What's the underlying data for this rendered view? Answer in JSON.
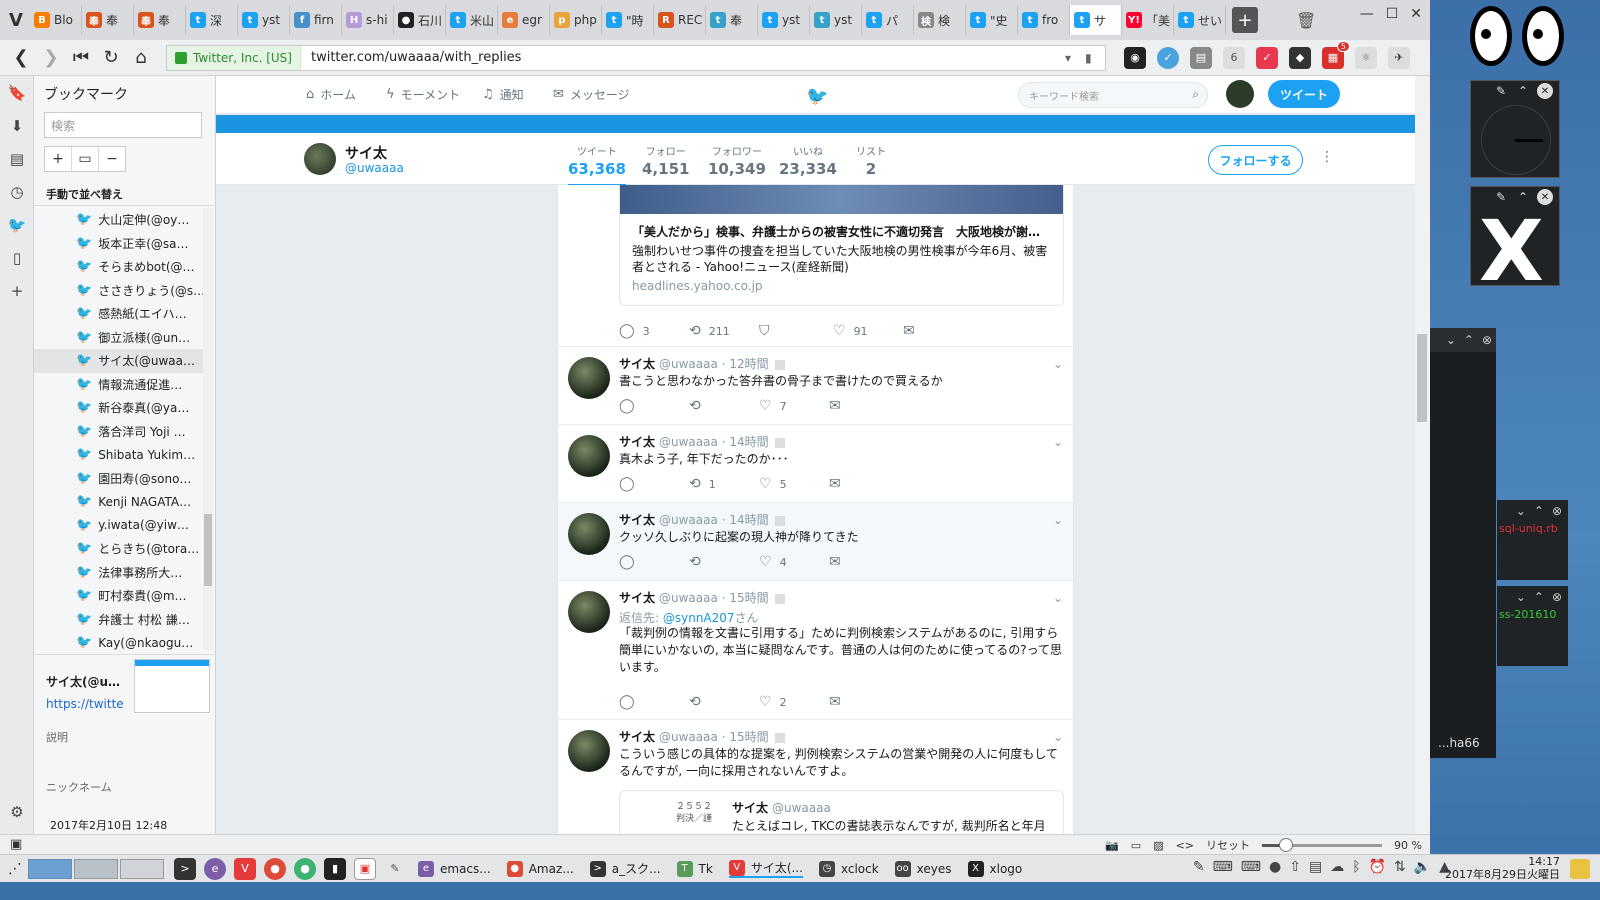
{
  "browser": {
    "tabs": [
      {
        "label": "Blo",
        "icon": "blogger-icon",
        "color": "#f57d00",
        "glyph": "B"
      },
      {
        "label": "奉",
        "icon": "fox-icon",
        "color": "#d9531e",
        "glyph": "奉"
      },
      {
        "label": "奉",
        "icon": "fox-icon",
        "color": "#d9531e",
        "glyph": "奉"
      },
      {
        "label": "深",
        "icon": "twitter-icon",
        "color": "#1da1f2",
        "glyph": "t"
      },
      {
        "label": "yst",
        "icon": "twitter-icon",
        "color": "#1da1f2",
        "glyph": "t"
      },
      {
        "label": "firn",
        "icon": "firn-icon",
        "color": "#4a90c8",
        "glyph": "f"
      },
      {
        "label": "s-hi",
        "icon": "s-icon",
        "color": "#b59ad8",
        "glyph": "H"
      },
      {
        "label": "石川",
        "icon": "github-icon",
        "color": "#222222",
        "glyph": "●"
      },
      {
        "label": "米山",
        "icon": "twitter-icon",
        "color": "#1da1f2",
        "glyph": "t"
      },
      {
        "label": "egr",
        "icon": "egr-icon",
        "color": "#e57c3a",
        "glyph": "e"
      },
      {
        "label": "php",
        "icon": "php-icon",
        "color": "#e8a33a",
        "glyph": "p"
      },
      {
        "label": "\"時",
        "icon": "twitter-icon",
        "color": "#1da1f2",
        "glyph": "t"
      },
      {
        "label": "REC",
        "icon": "rec-icon",
        "color": "#d9531e",
        "glyph": "R"
      },
      {
        "label": "奉",
        "icon": "tumblr-icon",
        "color": "#35a0c8",
        "glyph": "t"
      },
      {
        "label": "yst",
        "icon": "twitter-icon",
        "color": "#1da1f2",
        "glyph": "t"
      },
      {
        "label": "yst",
        "icon": "tumblr-icon",
        "color": "#35a0c8",
        "glyph": "t"
      },
      {
        "label": "パ",
        "icon": "twitter-icon",
        "color": "#1da1f2",
        "glyph": "t"
      },
      {
        "label": "検",
        "icon": "page-icon",
        "color": "#888888",
        "glyph": "検"
      },
      {
        "label": "\"史",
        "icon": "twitter-icon",
        "color": "#1da1f2",
        "glyph": "t"
      },
      {
        "label": "fro",
        "icon": "twitter-icon",
        "color": "#1da1f2",
        "glyph": "t"
      },
      {
        "label": "サ",
        "icon": "twitter-icon",
        "color": "#1da1f2",
        "glyph": "t",
        "active": true
      },
      {
        "label": "「美",
        "icon": "yahoo-icon",
        "color": "#ff0033",
        "glyph": "Y!"
      },
      {
        "label": "せい",
        "icon": "twitter-icon",
        "color": "#1da1f2",
        "glyph": "t"
      }
    ],
    "cert": "Twitter, Inc. [US]",
    "url": "twitter.com/uwaaaa/with_replies",
    "extension_badge": "5"
  },
  "sidepanel": {
    "title": "ブックマーク",
    "search_placeholder": "検索",
    "sort_label": "手動で並べ替え",
    "bookmarks": [
      "大山定伸(@oy…",
      "坂本正幸(@sa…",
      "そらまめbot(@…",
      "ささきりょう(@s…",
      "感熱紙(エイハ…",
      "御立派様(@un…",
      "サイ太(@uwaa…",
      "情報流通促進…",
      "新谷泰真(@ya…",
      "落合洋司 Yoji …",
      "Shibata Yukim…",
      "園田寿(@sono…",
      "Kenji NAGATA…",
      "y.iwata(@yiw…",
      "とらきち(@tora…",
      "法律事務所大…",
      "町村泰貴(@m…",
      "弁護士 村松 謙…",
      "Kay(@nkaogu…"
    ],
    "selected_index": 6,
    "detail": {
      "name": "サイ太(@u…",
      "link": "https://twitte",
      "desc_label": "説明",
      "nick_label": "ニックネーム",
      "date": "2017年2月10日 12:48"
    }
  },
  "twitter": {
    "nav": {
      "home": "ホーム",
      "moments": "モーメント",
      "notifications": "通知",
      "messages": "メッセージ",
      "search_placeholder": "キーワード検索",
      "tweet_button": "ツイート"
    },
    "profile": {
      "name": "サイ太",
      "handle": "@uwaaaa",
      "follow_button": "フォローする",
      "stats": [
        {
          "label": "ツイート",
          "value": "63,368"
        },
        {
          "label": "フォロー",
          "value": "4,151"
        },
        {
          "label": "フォロワー",
          "value": "10,349"
        },
        {
          "label": "いいね",
          "value": "23,334"
        },
        {
          "label": "リスト",
          "value": "2"
        }
      ]
    },
    "card": {
      "title": "「美人だから」検事、弁護士からの被害女性に不適切発言　大阪地検が謝…",
      "description": "強制わいせつ事件の捜査を担当していた大阪地検の男性検事が今年6月、被害者とされる - Yahoo!ニュース(産経新聞)",
      "domain": "headlines.yahoo.co.jp",
      "replies": "3",
      "retweets": "211",
      "likes": "91"
    },
    "tweets": [
      {
        "name": "サイ太",
        "handle": "@uwaaaa",
        "time": "· 12時間",
        "text": "書こうと思わなかった答弁書の骨子まで書けたので買えるか",
        "replies": "",
        "retweets": "",
        "likes": "7"
      },
      {
        "name": "サイ太",
        "handle": "@uwaaaa",
        "time": "· 14時間",
        "text": "真木よう子, 年下だったのか･･･",
        "replies": "",
        "retweets": "1",
        "likes": "5"
      },
      {
        "name": "サイ太",
        "handle": "@uwaaaa",
        "time": "· 14時間",
        "text": "クッソ久しぶりに起案の現人神が降りてきた",
        "replies": "",
        "retweets": "",
        "likes": "4"
      },
      {
        "name": "サイ太",
        "handle": "@uwaaaa",
        "time": "· 15時間",
        "reply_prefix": "返信先: ",
        "reply_to": "@synnA207",
        "reply_suffix": "さん",
        "text": "「裁判例の情報を文書に引用する」ために判例検索システムがあるのに, 引用すら簡単にいかないの, 本当に疑問なんです。普通の人は何のために使ってるの?って思います。",
        "replies": "",
        "retweets": "",
        "likes": "2"
      },
      {
        "name": "サイ太",
        "handle": "@uwaaaa",
        "time": "· 15時間",
        "text": "こういう感じの具体的な提案を, 判例検索システムの営業や開発の人に何度もしてるんですが, 一向に採用されないんですよ。"
      }
    ],
    "quote": {
      "thumb_text": "２５５２\n判決／謹",
      "name": "サイ太",
      "handle": "@uwaaaa",
      "text": "たとえばコレ, TKCの書誌表示なんですが, 裁判所名と年月"
    }
  },
  "statusbar": {
    "reset": "リセット",
    "zoom": "90 %",
    "zoom_fraction": 0.2
  },
  "desktop": {
    "term_tail": "...ha66",
    "term_b1": "sql-uniq.rb",
    "term_b2": "ss-201610"
  },
  "taskbar": {
    "apps": [
      {
        "label": "emacs...",
        "icon": "emacs-icon",
        "color": "#7b5ea7",
        "glyph": "e"
      },
      {
        "label": "Amaz...",
        "icon": "chrome-icon",
        "color": "#dd4b39",
        "glyph": "●"
      },
      {
        "label": "a_スク...",
        "icon": "terminal-icon",
        "color": "#333333",
        "glyph": ">"
      },
      {
        "label": "Tk",
        "icon": "tk-icon",
        "color": "#5a9a5a",
        "glyph": "T"
      },
      {
        "label": "サイ太(...",
        "icon": "vivaldi-icon",
        "color": "#e43a3a",
        "glyph": "V",
        "active": true
      },
      {
        "label": "xclock",
        "icon": "clock-icon",
        "color": "#444444",
        "glyph": "◷"
      },
      {
        "label": "xeyes",
        "icon": "eyes-icon",
        "color": "#444444",
        "glyph": "oo"
      },
      {
        "label": "xlogo",
        "icon": "x-icon",
        "color": "#222222",
        "glyph": "X"
      }
    ],
    "time": "14:17",
    "date": "2017年8月29日火曜日"
  }
}
